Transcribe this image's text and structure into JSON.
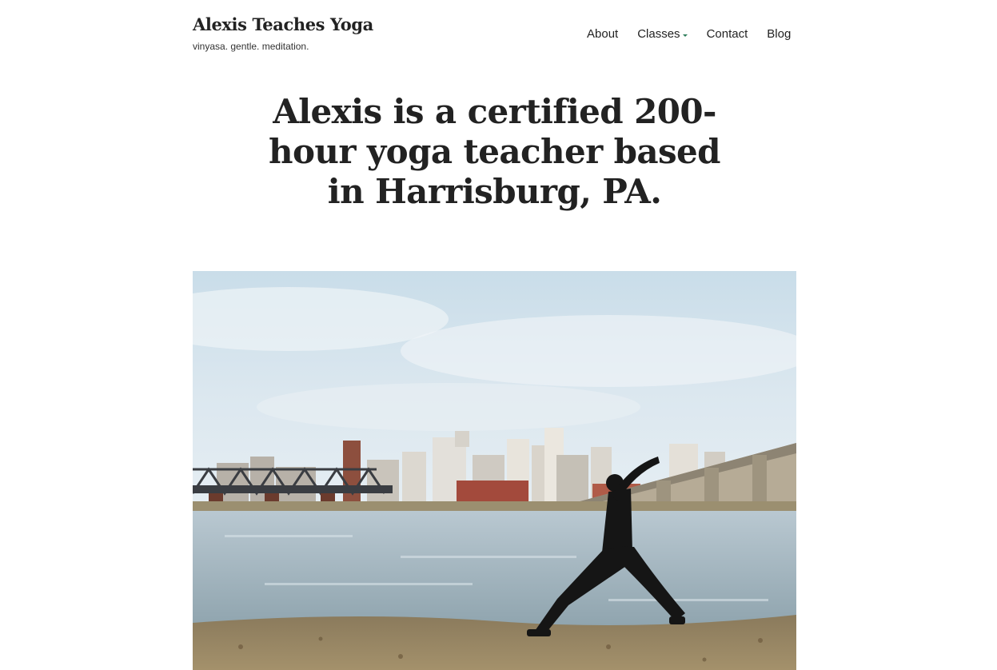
{
  "site": {
    "title": "Alexis Teaches Yoga",
    "tagline": "vinyasa. gentle. meditation."
  },
  "nav": {
    "items": [
      {
        "label": "About"
      },
      {
        "label": "Classes",
        "has_dropdown": true,
        "icon": "caret-down-icon"
      },
      {
        "label": "Contact"
      },
      {
        "label": "Blog"
      }
    ],
    "accent_color": "#2e7d5b"
  },
  "hero": {
    "heading": "Alexis is a certified 200-hour yoga teacher based in Harrisburg, PA."
  },
  "colors": {
    "text": "#222222",
    "background": "#ffffff"
  }
}
